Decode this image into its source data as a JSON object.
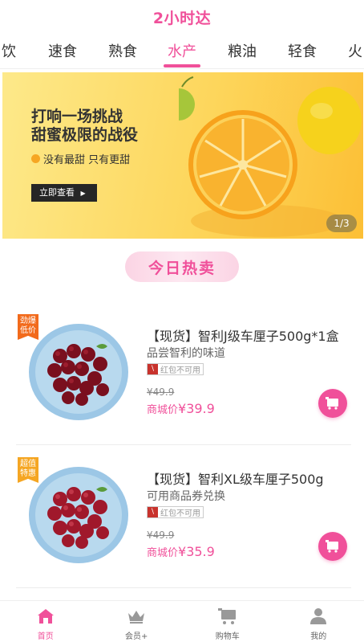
{
  "header": {
    "logo_text": "2小时达"
  },
  "categories": {
    "items": [
      "饮",
      "速食",
      "熟食",
      "水产",
      "粮油",
      "轻食",
      "火"
    ],
    "active": "水产"
  },
  "banner": {
    "title_line1": "打响一场挑战",
    "title_line2": "甜蜜极限的战役",
    "subtitle": "没有最甜 只有更甜",
    "button_label": "立即查看",
    "page_indicator": "1/3"
  },
  "section": {
    "hot_title": "今日热卖"
  },
  "products": [
    {
      "tag": "劲爆低价",
      "tag_color": "#f26a1b",
      "name": "【现货】智利J级车厘子500g*1盒",
      "desc": "品尝智利的味道",
      "coupon": "红包不可用",
      "old_price": "¥49.9",
      "price_label": "商城价",
      "price": "¥39.9"
    },
    {
      "tag": "超值特惠",
      "tag_color": "#f5a623",
      "name": "【现货】智利XL级车厘子500g",
      "desc": "可用商品券兑换",
      "coupon": "红包不可用",
      "old_price": "¥49.9",
      "price_label": "商城价",
      "price": "¥35.9"
    }
  ],
  "tabbar": {
    "items": [
      {
        "label": "首页",
        "icon": "home-icon",
        "active": true
      },
      {
        "label": "会员+",
        "icon": "crown-icon",
        "active": false
      },
      {
        "label": "购物车",
        "icon": "cart-icon",
        "active": false
      },
      {
        "label": "我的",
        "icon": "user-icon",
        "active": false
      }
    ]
  },
  "colors": {
    "accent": "#f0509a",
    "banner_yellow": "#fdd65c"
  }
}
